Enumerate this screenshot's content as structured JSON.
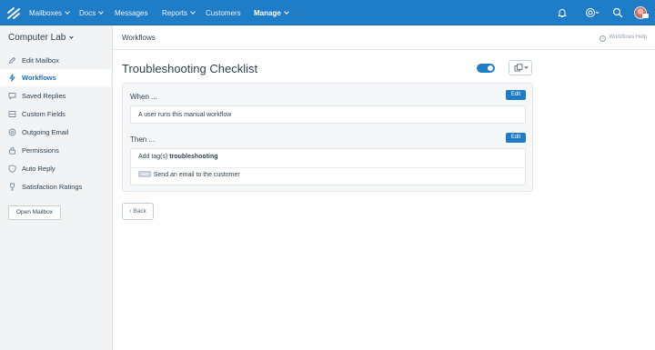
{
  "nav": {
    "items": [
      {
        "label": "Mailboxes",
        "dropdown": true
      },
      {
        "label": "Docs",
        "dropdown": true
      },
      {
        "label": "Messages",
        "dropdown": false
      },
      {
        "label": "Reports",
        "dropdown": true
      },
      {
        "label": "Customers",
        "dropdown": false
      },
      {
        "label": "Manage",
        "dropdown": true,
        "active": true
      }
    ],
    "icons": [
      "helpscout-logo-icon",
      "bell-icon",
      "lifebuoy-icon",
      "search-icon",
      "avatar"
    ]
  },
  "sidebar": {
    "mailbox_name": "Computer Lab",
    "items": [
      {
        "label": "Edit Mailbox",
        "icon": "pencil-icon"
      },
      {
        "label": "Workflows",
        "icon": "bolt-icon",
        "active": true
      },
      {
        "label": "Saved Replies",
        "icon": "chat-bubble-icon"
      },
      {
        "label": "Custom Fields",
        "icon": "list-icon"
      },
      {
        "label": "Outgoing Email",
        "icon": "at-sign-icon"
      },
      {
        "label": "Permissions",
        "icon": "lock-icon"
      },
      {
        "label": "Auto Reply",
        "icon": "shield-reply-icon"
      },
      {
        "label": "Satisfaction Ratings",
        "icon": "trophy-icon"
      }
    ],
    "open_mailbox_label": "Open Mailbox"
  },
  "header": {
    "title": "Workflows",
    "help_label": "Workflows Help",
    "help_icon_glyph": "i"
  },
  "workflow": {
    "title": "Troubleshooting Checklist",
    "enabled": true,
    "accent": "#1f7cc7",
    "when": {
      "label": "When ...",
      "edit_label": "Edit",
      "condition": "A user runs this manual workflow"
    },
    "then": {
      "label": "Then ...",
      "edit_label": "Edit",
      "action_prefix": "Add tag(s)",
      "action_tag": "troubleshooting",
      "and_badge": "AND",
      "second_action": "Send an email to the customer"
    }
  },
  "back_label": "Back",
  "back_glyph": "‹"
}
